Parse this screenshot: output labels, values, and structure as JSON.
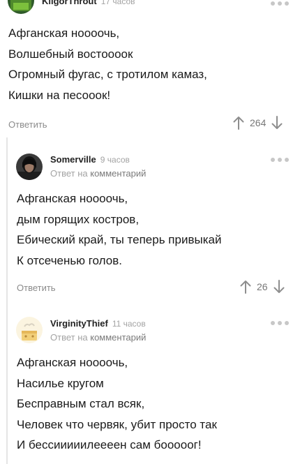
{
  "comments": [
    {
      "username": "KilgorThrout",
      "time": "17 часов",
      "lines": [
        "Афганская ноооочь,",
        "Волшебный востоооок",
        "Огромный фугас, с тротилом камаз,",
        "Кишки на песооок!"
      ],
      "reply_label": "Ответить",
      "votes": "264"
    },
    {
      "username": "Somerville",
      "time": "9 часов",
      "reply_prefix": "Ответ на",
      "reply_target": "комментарий",
      "lines": [
        "Афганская ноооочь,",
        "дым горящих костров,",
        "Ебический край, ты теперь привыкай",
        "К отсеченью голов."
      ],
      "reply_label": "Ответить",
      "votes": "26"
    },
    {
      "username": "VirginityThief",
      "time": "11 часов",
      "reply_prefix": "Ответ на",
      "reply_target": "комментарий",
      "lines": [
        "Афганская ноооочь,",
        "Насилье  кругом",
        "Бесправным стал всяк,",
        "Человек что червяк, убит просто так",
        "И бессииииилеееен сам бооооог!"
      ]
    }
  ],
  "colors": {
    "meta": "#a3a3a3",
    "action": "#8b8b8b",
    "thread_line": "#e5e5e5"
  },
  "icons": [
    "avatar",
    "more-dots-icon",
    "upvote-arrow-icon",
    "downvote-arrow-icon"
  ]
}
